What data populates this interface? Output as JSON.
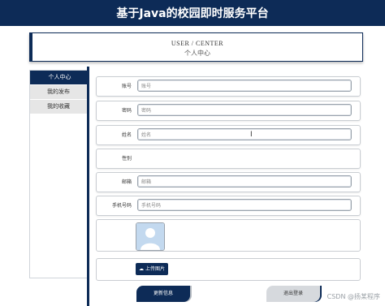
{
  "header": {
    "title": "基于Java的校园即时服务平台"
  },
  "user_center": {
    "title_en": "USER / CENTER",
    "title_cn": "个人中心"
  },
  "sidebar": {
    "items": [
      {
        "label": "个人中心"
      },
      {
        "label": "我的发布"
      },
      {
        "label": "我的收藏"
      }
    ]
  },
  "form": {
    "fields": [
      {
        "label": "账号",
        "placeholder": "账号"
      },
      {
        "label": "密码",
        "placeholder": "密码"
      },
      {
        "label": "姓名",
        "placeholder": "姓名"
      },
      {
        "label": "性别"
      },
      {
        "label": "邮箱",
        "placeholder": "邮箱"
      },
      {
        "label": "手机号码",
        "placeholder": "手机号码"
      }
    ],
    "upload_label": "上传图片",
    "update_label": "更新信息",
    "logout_label": "退出登录"
  },
  "watermark": "CSDN @扬某程序"
}
